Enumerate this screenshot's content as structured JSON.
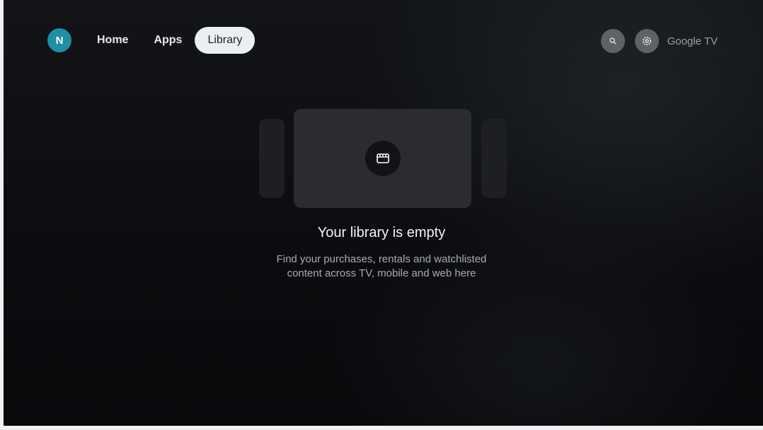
{
  "profile": {
    "initial": "N",
    "color": "#1e8fa5"
  },
  "nav": {
    "tabs": [
      {
        "label": "Home",
        "selected": false
      },
      {
        "label": "Apps",
        "selected": false
      },
      {
        "label": "Library",
        "selected": true
      }
    ]
  },
  "toolbar": {
    "search_icon": "search-icon",
    "settings_icon": "gear-icon",
    "brand": "Google TV"
  },
  "empty_state": {
    "icon": "clapperboard-icon",
    "title": "Your library is empty",
    "subtitle_line1": "Find your purchases, rentals and watchlisted",
    "subtitle_line2": "content across TV, mobile and web here"
  }
}
